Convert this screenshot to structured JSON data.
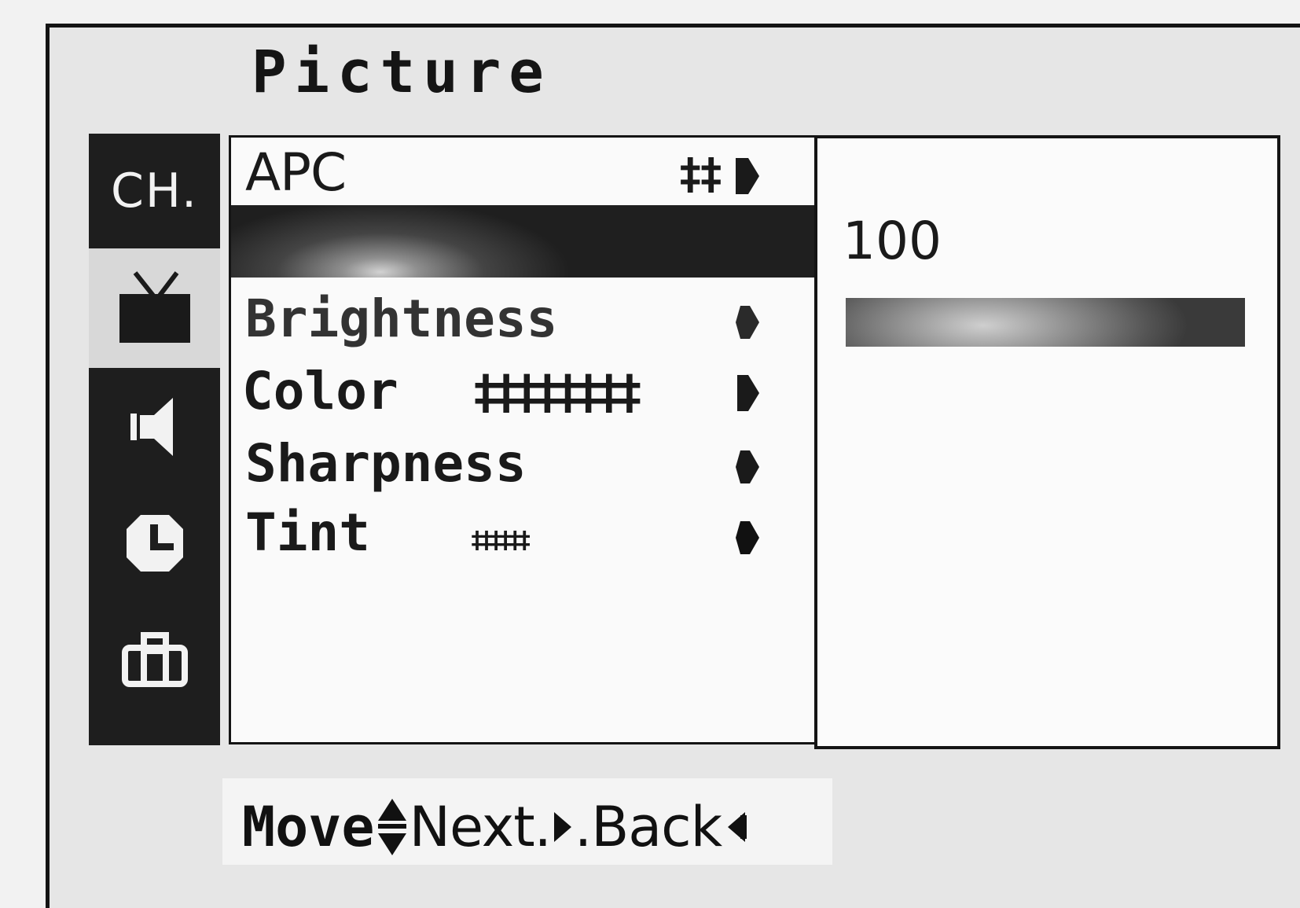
{
  "menu": {
    "title": "Picture",
    "tabs": [
      {
        "label": "CH.",
        "icon": "channel-text-icon",
        "active": false
      },
      {
        "icon": "tv-icon",
        "active": true
      },
      {
        "icon": "speaker-icon",
        "active": false
      },
      {
        "icon": "clock-icon",
        "active": false
      },
      {
        "icon": "toolbox-icon",
        "active": false
      }
    ],
    "items": [
      {
        "label": "APC",
        "ticks": "‡‡",
        "arrow": "right-arrow-icon"
      },
      {
        "label": "",
        "selected": true
      },
      {
        "label": "Brightness",
        "arrow": "right-arrow-icon"
      },
      {
        "label": "Color",
        "ticks": "‡‡‡‡‡‡‡‡",
        "arrow": "right-arrow-icon"
      },
      {
        "label": "Sharpness",
        "arrow": "right-arrow-icon"
      },
      {
        "label": "Tint",
        "ticks": "‡‡‡‡‡‡",
        "arrow": "right-arrow-icon"
      }
    ]
  },
  "value_panel": {
    "value": "100",
    "level": 1.0
  },
  "help": {
    "move": "Move",
    "next": "Next",
    "back": "Back",
    "separator": "."
  },
  "colors": {
    "background": "#e6e6e6",
    "sidebar": "#1e1e1e",
    "panel": "#fafafa",
    "text": "#1a1a1a",
    "highlight": "#2a2a2a"
  }
}
